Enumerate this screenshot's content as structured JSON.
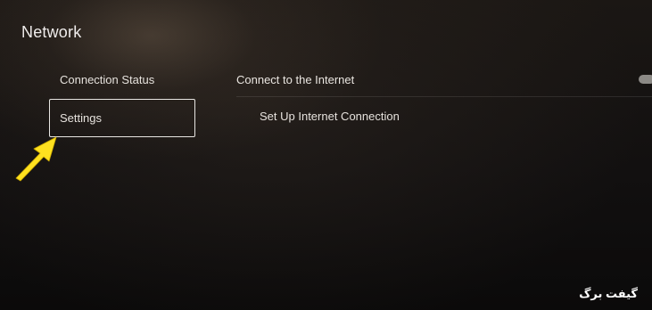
{
  "header": {
    "title": "Network"
  },
  "sidebar": {
    "items": [
      {
        "label": "Connection Status"
      },
      {
        "label": "Settings"
      }
    ]
  },
  "main": {
    "options": [
      {
        "label": "Connect to the Internet"
      }
    ],
    "links": [
      {
        "label": "Set Up Internet Connection"
      }
    ]
  },
  "watermark": {
    "text": "گیفت برگ"
  },
  "annotation": {
    "arrow_color": "#ffe11f"
  }
}
